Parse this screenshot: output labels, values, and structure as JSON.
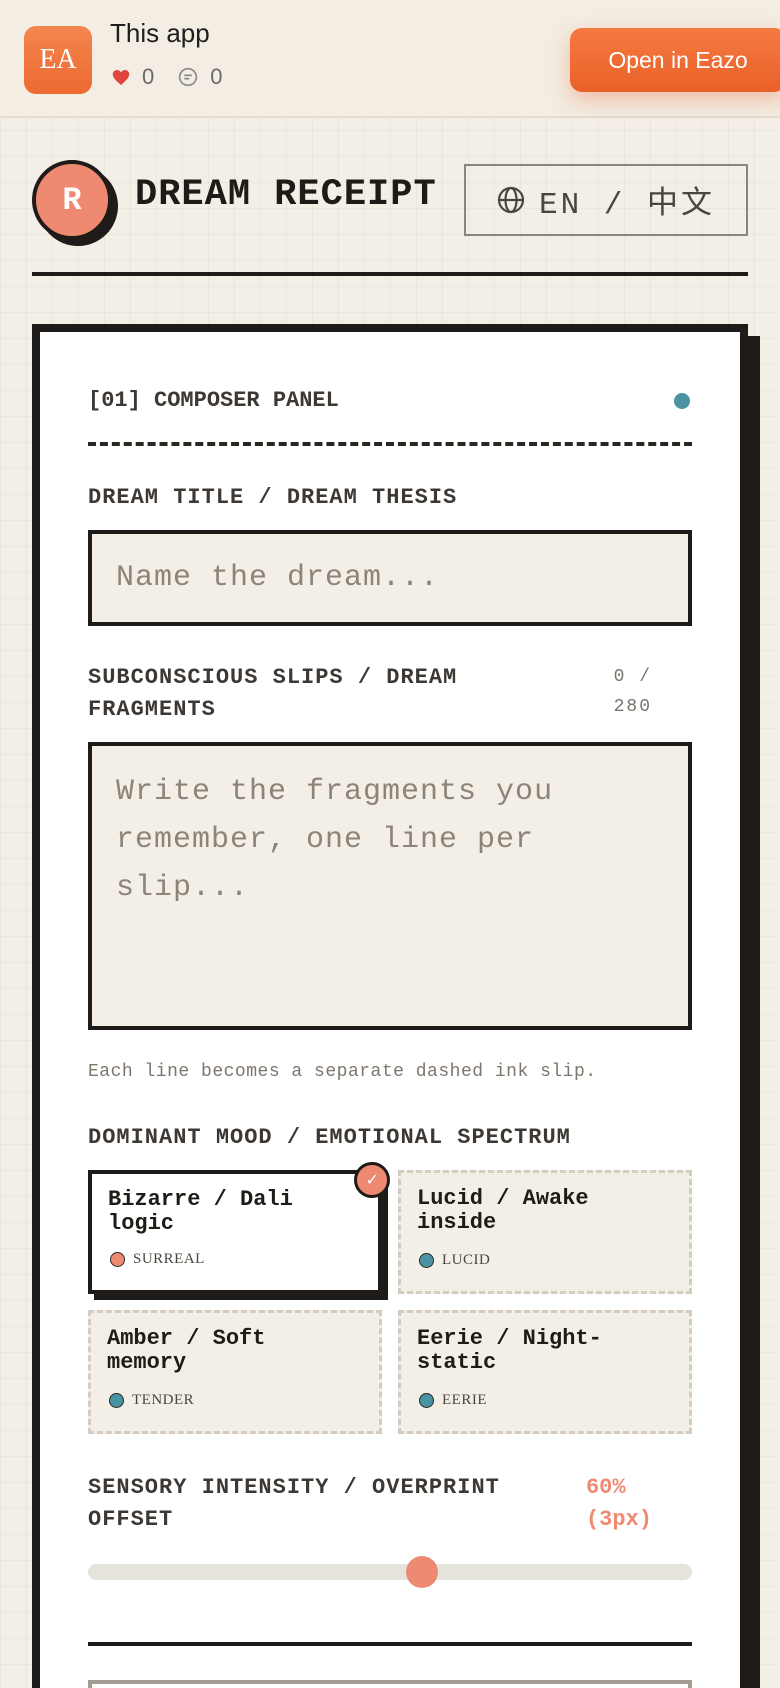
{
  "banner": {
    "app_icon_text": "EA",
    "app_name": "This app",
    "likes": "0",
    "comments": "0",
    "open_button": "Open in Eazo"
  },
  "header": {
    "logo_letter": "R",
    "title": "DREAM RECEIPT",
    "lang_toggle": "EN / 中文"
  },
  "panel": {
    "heading": "[01] COMPOSER PANEL",
    "title_label": "DREAM TITLE / DREAM THESIS",
    "title_placeholder": "Name the dream...",
    "fragments_label_line1": "SUBCONSCIOUS SLIPS / DREAM",
    "fragments_label_line2": "FRAGMENTS",
    "counter_line1": "0 /",
    "counter_line2": "280",
    "fragments_placeholder_line1": "Write the fragments you",
    "fragments_placeholder_line2": "remember, one line per",
    "fragments_placeholder_line3": "slip...",
    "hint": "Each line becomes a separate dashed ink slip.",
    "mood_label": "DOMINANT MOOD / EMOTIONAL SPECTRUM",
    "moods": [
      {
        "title_line1": "Bizarre / Dali",
        "title_line2": "logic",
        "tag": "SURREAL",
        "color": "#ef8a72",
        "selected": true
      },
      {
        "title_line1": "Lucid / Awake",
        "title_line2": "inside",
        "tag": "LUCID",
        "color": "#4a93a3",
        "selected": false
      },
      {
        "title_line1": "Amber / Soft",
        "title_line2": "memory",
        "tag": "TENDER",
        "color": "#4a93a3",
        "selected": false
      },
      {
        "title_line1": "Eerie / Night-",
        "title_line2": "static",
        "tag": "EERIE",
        "color": "#4a93a3",
        "selected": false
      }
    ],
    "intensity_label_line1": "SENSORY INTENSITY / OVERPRINT",
    "intensity_label_line2": "OFFSET",
    "intensity_value_line1": "60%",
    "intensity_value_line2": "(3px)",
    "intensity_percent": 60
  },
  "colors": {
    "accent": "#ef8a72",
    "teal": "#4a93a3",
    "ink": "#1e1b18",
    "paper": "#f4efe6",
    "banner_button": "#ea6128"
  }
}
